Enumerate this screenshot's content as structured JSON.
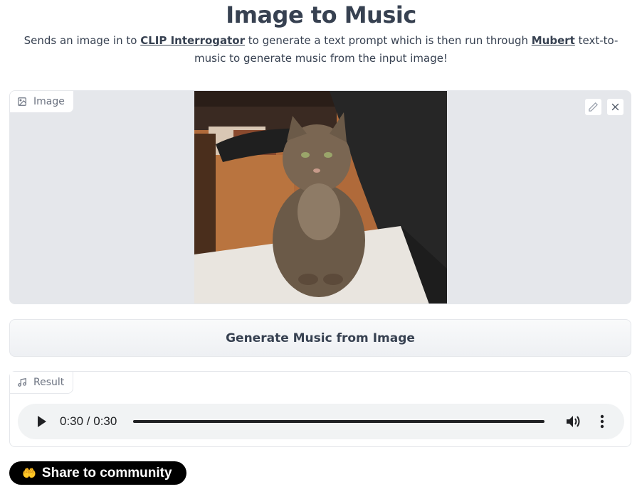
{
  "header": {
    "title": "Image to Music",
    "desc_part1": "Sends an image in to ",
    "link1": "CLIP Interrogator",
    "desc_part2": " to generate a text prompt which is then run through ",
    "link2": "Mubert",
    "desc_part3": " text-to-music to generate music from the input image!"
  },
  "image_panel": {
    "label": "Image",
    "label_icon": "image-icon",
    "edit_icon": "pencil-icon",
    "clear_icon": "close-icon"
  },
  "generate_button": {
    "label": "Generate Music from Image"
  },
  "result_panel": {
    "label": "Result",
    "label_icon": "music-note-icon",
    "player": {
      "time_display": "0:30 / 0:30",
      "progress": 1.0,
      "play_icon": "play-icon",
      "volume_icon": "volume-icon",
      "more_icon": "more-vertical-icon"
    }
  },
  "share_button": {
    "label": "Share to community",
    "icon": "🤲"
  },
  "colors": {
    "text": "#374151",
    "panel_bg": "#e5e7eb",
    "share_bg": "#000000"
  }
}
